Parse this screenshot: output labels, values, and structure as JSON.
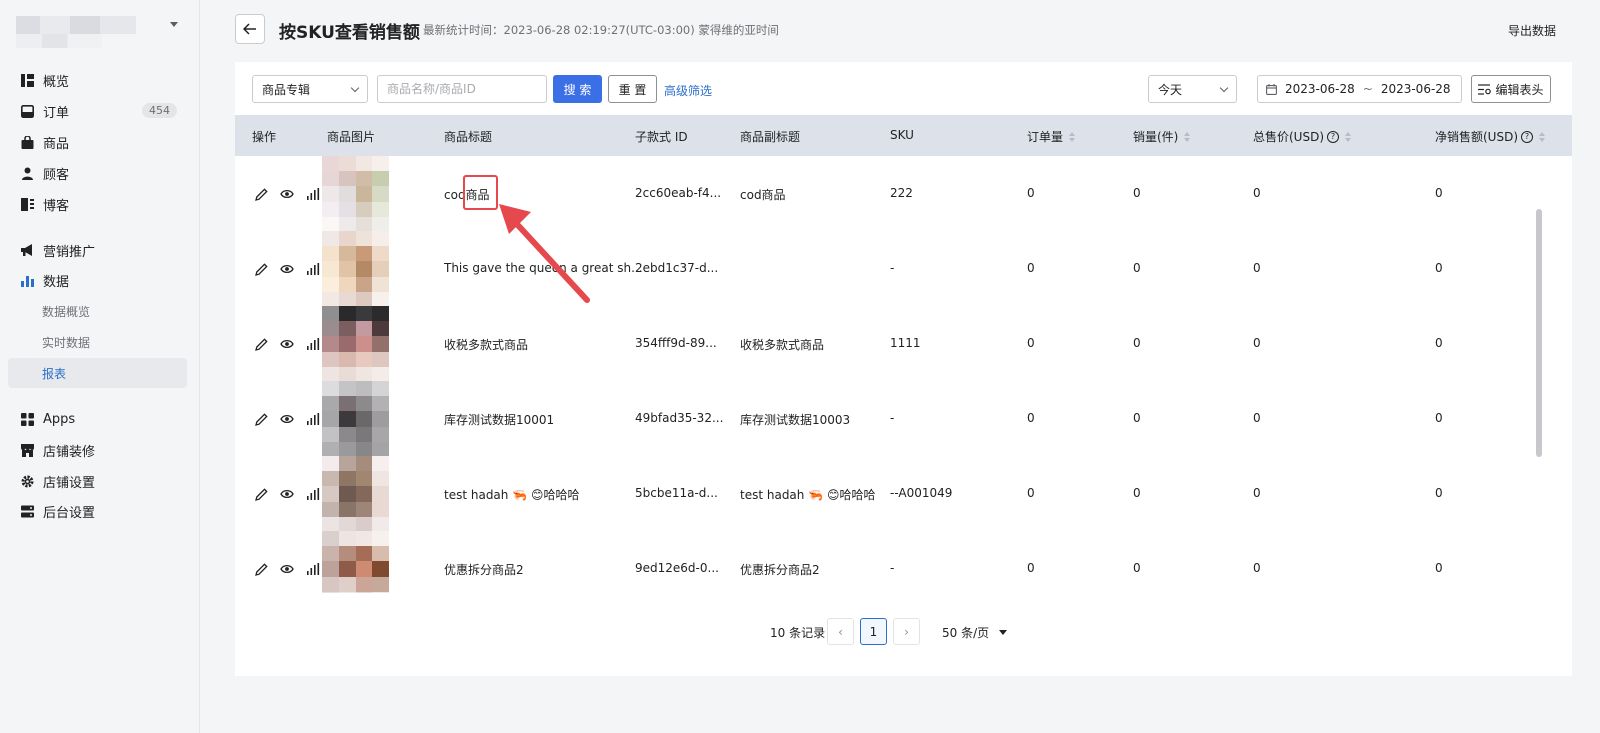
{
  "sidebar": {
    "items": [
      {
        "label": "概览",
        "icon": "overview-icon"
      },
      {
        "label": "订单",
        "icon": "orders-icon",
        "badge": "454"
      },
      {
        "label": "商品",
        "icon": "products-icon"
      },
      {
        "label": "顾客",
        "icon": "customers-icon"
      },
      {
        "label": "博客",
        "icon": "blog-icon"
      },
      {
        "label": "营销推广",
        "icon": "marketing-icon"
      },
      {
        "label": "数据",
        "icon": "analytics-icon"
      },
      {
        "label": "Apps",
        "icon": "apps-icon"
      },
      {
        "label": "店铺装修",
        "icon": "store-design-icon"
      },
      {
        "label": "店铺设置",
        "icon": "settings-icon"
      },
      {
        "label": "后台设置",
        "icon": "admin-settings-icon"
      }
    ],
    "sub_items": [
      "数据概览",
      "实时数据",
      "报表"
    ],
    "active_sub": "报表"
  },
  "header": {
    "title": "按SKU查看销售额",
    "stat_time": "最新统计时间：2023-06-28 02:19:27(UTC-03:00) 蒙得维的亚时间",
    "export_label": "导出数据"
  },
  "filters": {
    "category_select": "商品专辑",
    "search_placeholder": "商品名称/商品ID",
    "search_label": "搜 索",
    "reset_label": "重 置",
    "advanced_label": "高级筛选",
    "period_select": "今天",
    "date_start": "2023-06-28",
    "date_sep": "~",
    "date_end": "2023-06-28",
    "edit_columns_label": "编辑表头"
  },
  "table": {
    "headers": [
      "操作",
      "商品图片",
      "商品标题",
      "子款式 ID",
      "商品副标题",
      "SKU",
      "订单量",
      "销量(件)",
      "总售价(USD)",
      "净销售额(USD)"
    ],
    "rows": [
      {
        "title": "cod商品",
        "variant_id": "2cc60eab-f4...",
        "subtitle": "cod商品",
        "sku": "222",
        "orders": "0",
        "qty": "0",
        "gross": "0",
        "net": "0"
      },
      {
        "title": "This gave the queen a great sh...",
        "variant_id": "2ebd1c37-d...",
        "subtitle": "",
        "sku": "-",
        "orders": "0",
        "qty": "0",
        "gross": "0",
        "net": "0"
      },
      {
        "title": "收税多款式商品",
        "variant_id": "354fff9d-89...",
        "subtitle": "收税多款式商品",
        "sku": "1111",
        "orders": "0",
        "qty": "0",
        "gross": "0",
        "net": "0"
      },
      {
        "title": "库存测试数据10001",
        "variant_id": "49bfad35-32...",
        "subtitle": "库存测试数据10003",
        "sku": "-",
        "orders": "0",
        "qty": "0",
        "gross": "0",
        "net": "0"
      },
      {
        "title": "test hadah 🦐 😊哈哈哈",
        "variant_id": "5bcbe11a-d...",
        "subtitle": "test hadah 🦐 😊哈哈哈",
        "sku": "--A001049",
        "orders": "0",
        "qty": "0",
        "gross": "0",
        "net": "0"
      },
      {
        "title": "优惠拆分商品2",
        "variant_id": "9ed12e6d-0...",
        "subtitle": "优惠拆分商品2",
        "sku": "-",
        "orders": "0",
        "qty": "0",
        "gross": "0",
        "net": "0"
      }
    ]
  },
  "pagination": {
    "total": "10 条记录",
    "current_page": "1",
    "page_size": "50 条/页"
  },
  "colors": {
    "accent": "#3b6fe6",
    "link": "#2c6ecb",
    "highlight": "#e5484d"
  }
}
